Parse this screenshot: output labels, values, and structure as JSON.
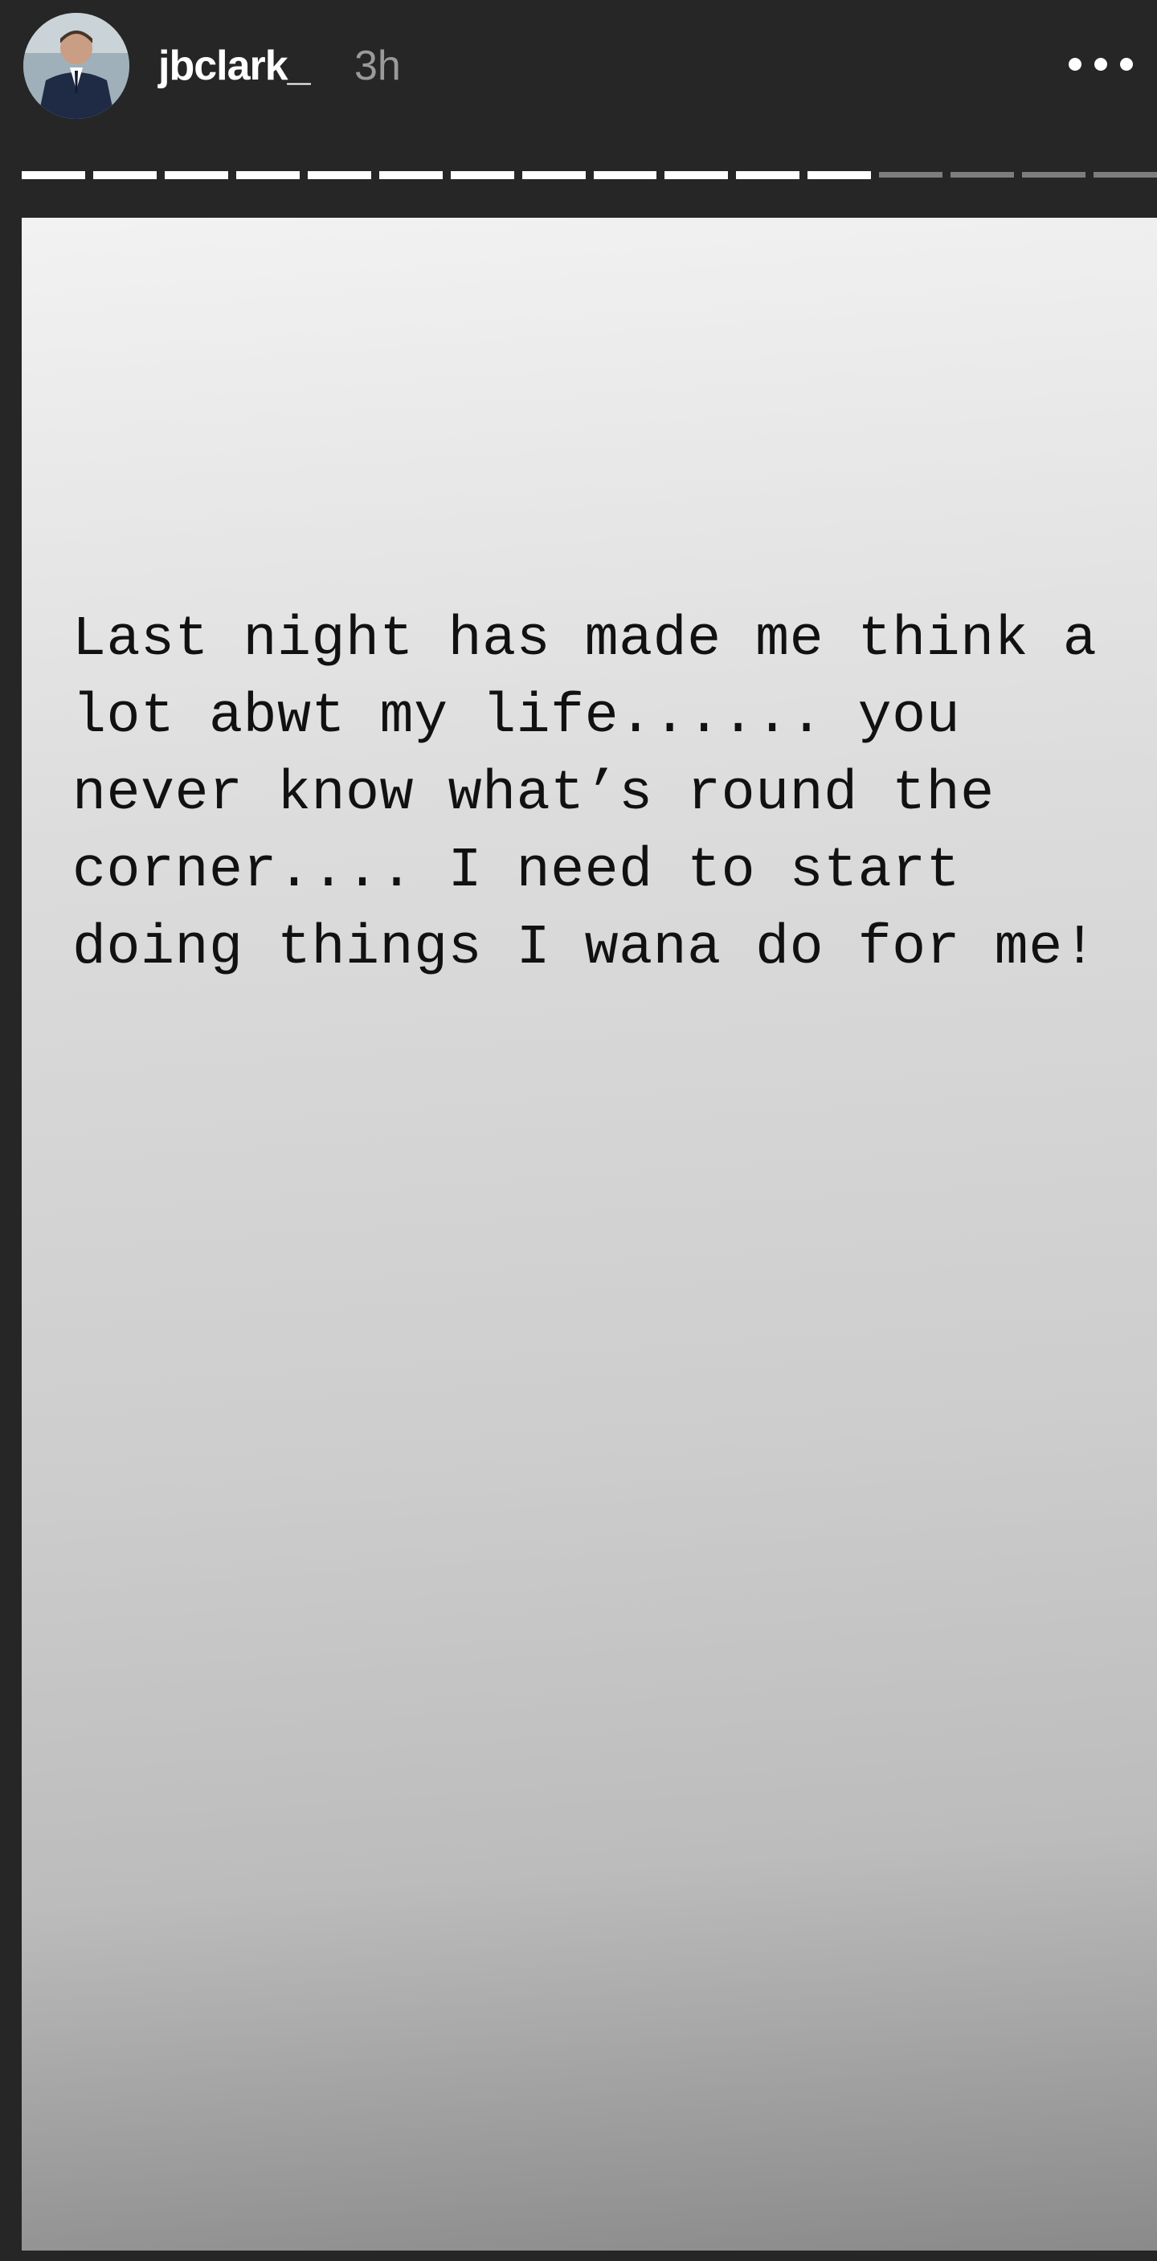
{
  "header": {
    "username": "jbclark_",
    "timestamp": "3h",
    "avatar_icon": "profile-photo-icon",
    "more_icon": "more-options-icon"
  },
  "progress": {
    "total_segments": 16,
    "completed_segments": 12,
    "completed_color": "#ffffff",
    "pending_color": "#7d7d7d"
  },
  "story": {
    "text": "Last night has made me think a lot abwt my life...... you never know what’s round the corner.... I need to start doing things I wana do for me!"
  },
  "colors": {
    "background": "#262626",
    "username": "#ffffff",
    "timestamp": "#9a9a9a",
    "story_text": "#111111"
  }
}
